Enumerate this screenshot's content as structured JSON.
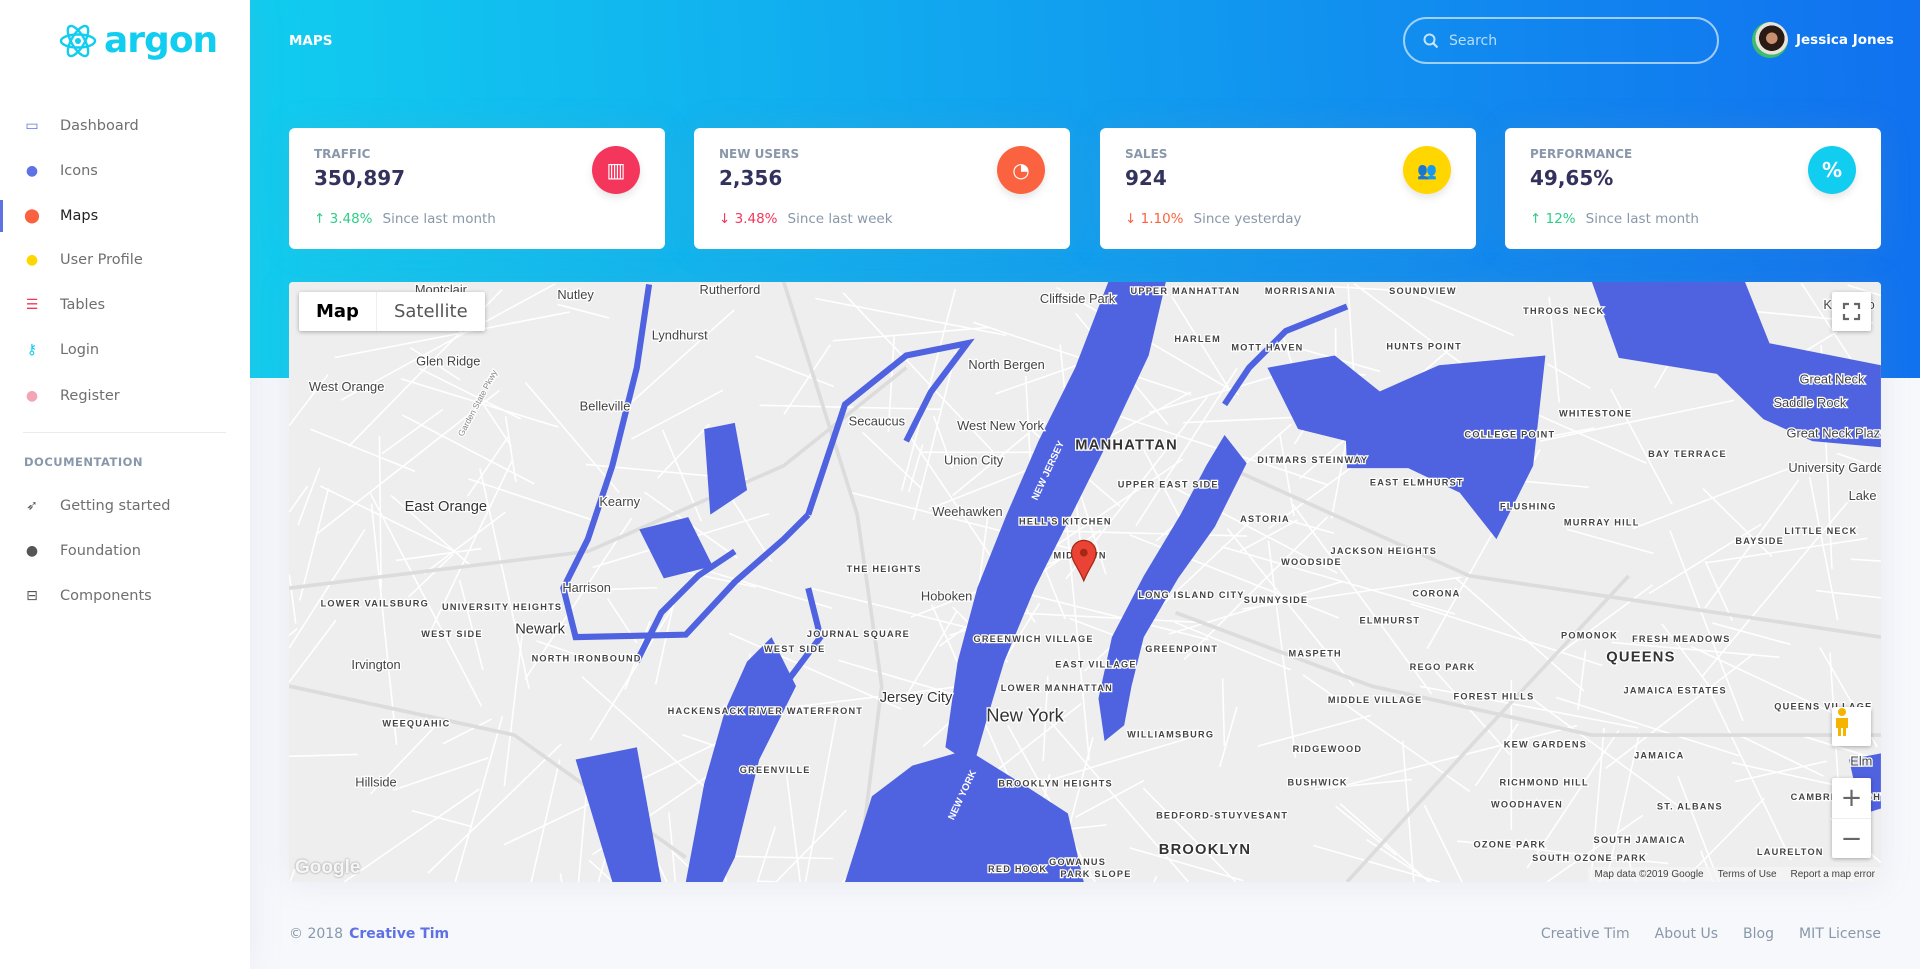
{
  "brand": {
    "name": "argon",
    "color": "#11cdef"
  },
  "sidebar": {
    "items": [
      {
        "label": "Dashboard",
        "icon": "tv-icon",
        "color": "#5e72e4"
      },
      {
        "label": "Icons",
        "icon": "planet-icon",
        "color": "#5e72e4"
      },
      {
        "label": "Maps",
        "icon": "pin-icon",
        "color": "#fb6340",
        "active": true
      },
      {
        "label": "User Profile",
        "icon": "user-icon",
        "color": "#ffd600"
      },
      {
        "label": "Tables",
        "icon": "list-icon",
        "color": "#f5365c"
      },
      {
        "label": "Login",
        "icon": "key-icon",
        "color": "#11cdef"
      },
      {
        "label": "Register",
        "icon": "circle-user-icon",
        "color": "#f3a4b5"
      }
    ],
    "documentation_heading": "DOCUMENTATION",
    "doc_items": [
      {
        "label": "Getting started",
        "icon": "rocket-icon"
      },
      {
        "label": "Foundation",
        "icon": "palette-icon"
      },
      {
        "label": "Components",
        "icon": "components-icon"
      }
    ]
  },
  "header": {
    "title": "MAPS",
    "search_placeholder": "Search",
    "user_name": "Jessica Jones"
  },
  "cards": [
    {
      "title": "TRAFFIC",
      "value": "350,897",
      "icon": "bar-chart-icon",
      "icon_color": "#f5365c",
      "change": "3.48%",
      "direction": "up",
      "since": "Since last month"
    },
    {
      "title": "NEW USERS",
      "value": "2,356",
      "icon": "pie-chart-icon",
      "icon_color": "#fb6340",
      "change": "3.48%",
      "direction": "down",
      "since": "Since last week"
    },
    {
      "title": "SALES",
      "value": "924",
      "icon": "users-icon",
      "icon_color": "#ffd600",
      "change": "1.10%",
      "direction": "down",
      "since": "Since yesterday"
    },
    {
      "title": "PERFORMANCE",
      "value": "49,65%",
      "icon": "percent-icon",
      "icon_color": "#11cdef",
      "change": "12%",
      "direction": "up",
      "since": "Since last month"
    }
  ],
  "map": {
    "type_buttons": [
      "Map",
      "Satellite"
    ],
    "selected_type": "Map",
    "water_color": "#4f62e0",
    "google_logo": "Google",
    "attribution": [
      "Map data ©2019 Google",
      "Terms of Use",
      "Report a map error"
    ],
    "labels": [
      "Montclair",
      "Nutley",
      "Rutherford",
      "Cliffside Park",
      "UPPER MANHATTAN",
      "MORRISANIA",
      "SOUNDVIEW",
      "Lyndhurst",
      "THROGS NECK",
      "Kings Po",
      "Glen Ridge",
      "North Bergen",
      "HARLEM",
      "MOTT HAVEN",
      "HUNTS POINT",
      "West Orange",
      "Great Neck",
      "Belleville",
      "WHITESTONE",
      "Saddle Rock",
      "Secaucus",
      "West New York",
      "MANHATTAN",
      "COLLEGE POINT",
      "Great Neck Plaza",
      "Union City",
      "UPPER EAST SIDE",
      "DITMARS STEINWAY",
      "BAY TERRACE",
      "University Gardens",
      "East Orange",
      "Kearny",
      "Weehawken",
      "EAST ELMHURST",
      "FLUSHING",
      "Lake",
      "HELL'S KITCHEN",
      "ASTORIA",
      "MURRAY HILL",
      "BAYSIDE",
      "LITTLE NECK",
      "MIDTOWN",
      "JACKSON HEIGHTS",
      "WOODSIDE",
      "THE HEIGHTS",
      "Harrison",
      "Hoboken",
      "LONG ISLAND CITY",
      "SUNNYSIDE",
      "CORONA",
      "LOWER VAILSBURG",
      "UNIVERSITY HEIGHTS",
      "Newark",
      "WEST SIDE",
      "JOURNAL SQUARE",
      "GREENWICH VILLAGE",
      "ELMHURST",
      "POMONOK",
      "FRESH MEADOWS",
      "WEST SIDE",
      "NORTH IRONBOUND",
      "GREENPOINT",
      "EAST VILLAGE",
      "MASPETH",
      "REGO PARK",
      "QUEENS",
      "Irvington",
      "LOWER MANHATTAN",
      "HACKENSACK RIVER WATERFRONT",
      "Jersey City",
      "MIDDLE VILLAGE",
      "FOREST HILLS",
      "JAMAICA ESTATES",
      "QUEENS VILLAGE",
      "New York",
      "WEEQUAHIC",
      "WILLIAMSBURG",
      "RIDGEWOOD",
      "KEW GARDENS",
      "JAMAICA",
      "Hillside",
      "GREENVILLE",
      "BROOKLYN HEIGHTS",
      "BUSHWICK",
      "RICHMOND HILL",
      "Elm",
      "WOODHAVEN",
      "ST. ALBANS",
      "BEDFORD-STUYVESANT",
      "CAMBRIA HEIGHTS",
      "OZONE PARK",
      "SOUTH JAMAICA",
      "BROOKLYN",
      "SOUTH OZONE PARK",
      "LAURELTON",
      "GOWANUS",
      "RED HOOK",
      "PARK SLOPE",
      "NEW JERSEY",
      "NEW YORK",
      "Garden State Pkwy"
    ]
  },
  "footer": {
    "copyright": "© 2018",
    "brand_link": "Creative Tim",
    "links": [
      "Creative Tim",
      "About Us",
      "Blog",
      "MIT License"
    ]
  }
}
